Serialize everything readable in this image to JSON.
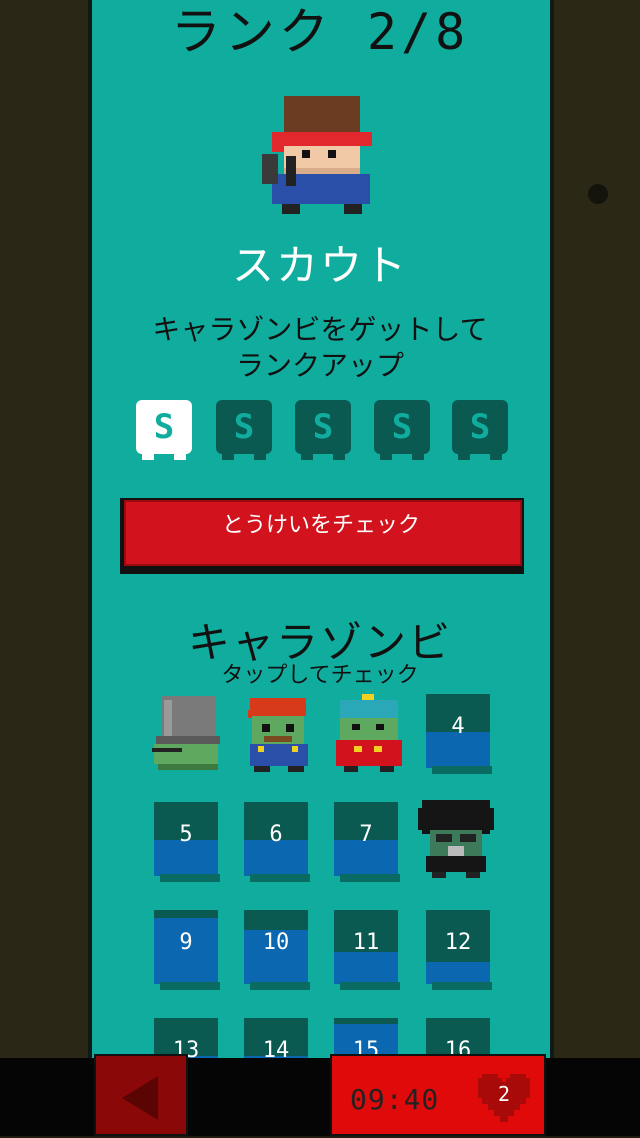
{
  "header": {
    "rank_title": "ランク 2/8"
  },
  "character": {
    "avatar": "scout-avatar-icon",
    "class_name": "スカウト"
  },
  "description": {
    "line1": "キャラゾンビをゲットして",
    "line2": "ランクアップ"
  },
  "badges": [
    {
      "letter": "S",
      "state": "earned"
    },
    {
      "letter": "S",
      "state": "locked"
    },
    {
      "letter": "S",
      "state": "locked"
    },
    {
      "letter": "S",
      "state": "locked"
    },
    {
      "letter": "S",
      "state": "locked"
    }
  ],
  "stats_button": {
    "label": "とうけいをチェック"
  },
  "zombies": {
    "title": "キャラゾンビ",
    "subtitle": "タップしてチェック",
    "cells": [
      {
        "label": "",
        "icon": "bucket-zombie-icon"
      },
      {
        "label": "",
        "icon": "plumber-zombie-icon"
      },
      {
        "label": "",
        "icon": "school-zombie-icon"
      },
      {
        "label": "4"
      },
      {
        "label": "5"
      },
      {
        "label": "6"
      },
      {
        "label": "7"
      },
      {
        "label": "",
        "icon": "afro-zombie-icon"
      },
      {
        "label": "9"
      },
      {
        "label": "10"
      },
      {
        "label": "11"
      },
      {
        "label": "12"
      },
      {
        "label": "13"
      },
      {
        "label": "14"
      },
      {
        "label": "15"
      },
      {
        "label": "16"
      }
    ]
  },
  "footer": {
    "back_icon": "back-arrow-icon",
    "timer": "09:40",
    "hearts": "2",
    "heart_icon": "heart-icon"
  },
  "colors": {
    "panel": "#10ad9e",
    "button_red": "#d2121c",
    "slot_dark": "#0a5a52",
    "slot_blue": "#0b67b0"
  }
}
